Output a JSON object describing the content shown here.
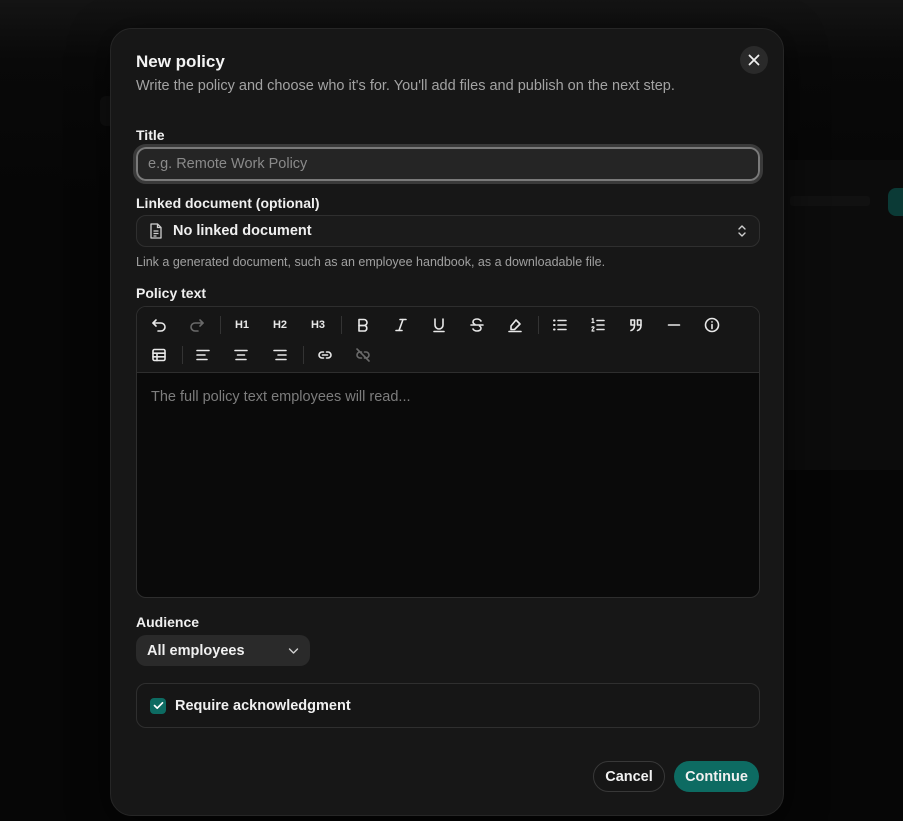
{
  "dialog": {
    "title": "New policy",
    "subtitle": "Write the policy and choose who it's for. You'll add files and publish on the next step."
  },
  "title_field": {
    "label": "Title",
    "value": "",
    "placeholder": "e.g. Remote Work Policy"
  },
  "linked_document": {
    "label": "Linked document (optional)",
    "value": "No linked document",
    "help": "Link a generated document, such as an employee handbook, as a downloadable file."
  },
  "policy_text": {
    "label": "Policy text",
    "placeholder": "The full policy text employees will read...",
    "toolbar": {
      "h1": "H1",
      "h2": "H2",
      "h3": "H3"
    }
  },
  "audience": {
    "label": "Audience",
    "value": "All employees"
  },
  "acknowledgment": {
    "label": "Require acknowledgment",
    "checked": true
  },
  "actions": {
    "cancel": "Cancel",
    "continue": "Continue"
  },
  "colors": {
    "accent": "#0d6b62",
    "modal_bg": "#171717"
  }
}
